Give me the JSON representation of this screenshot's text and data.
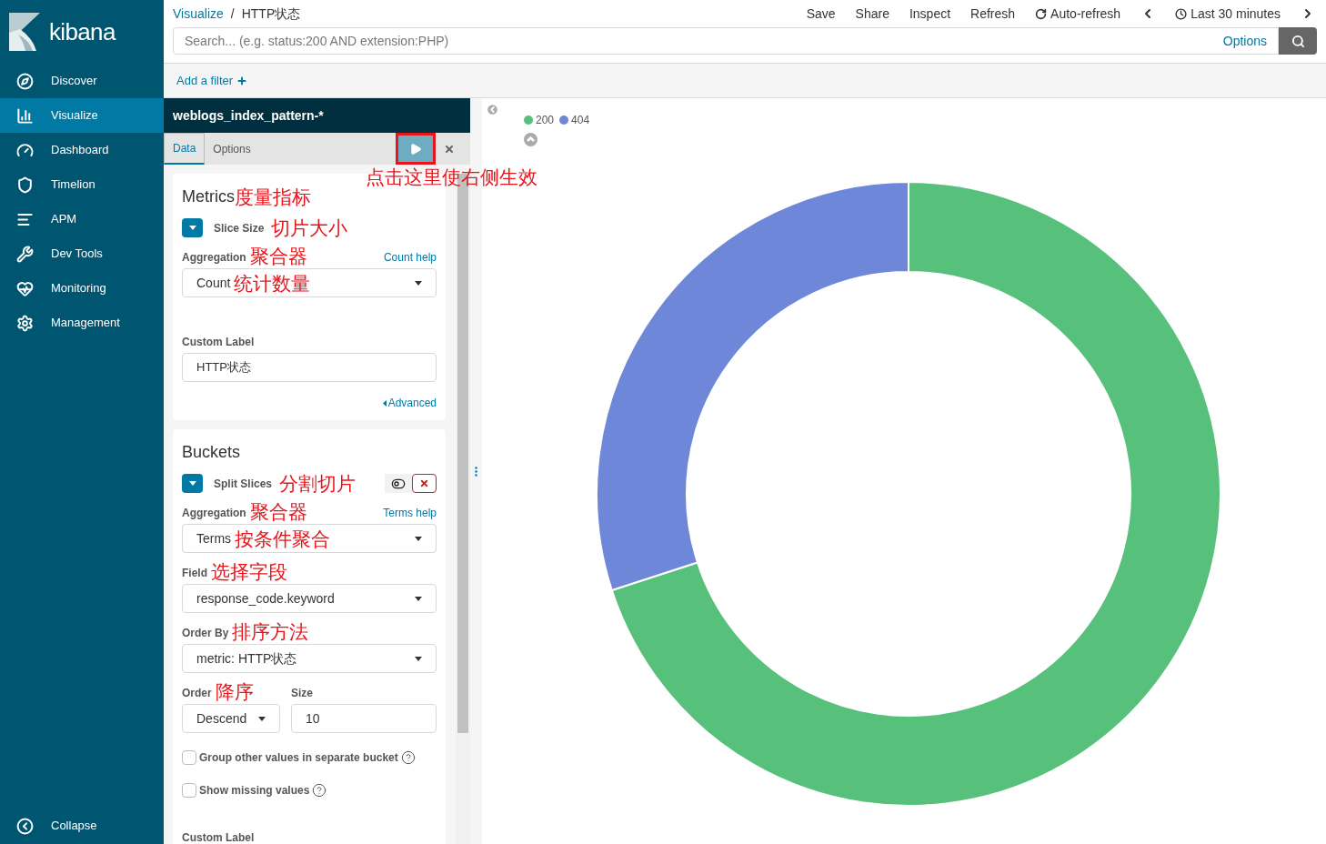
{
  "logo": {
    "text": "kibana"
  },
  "nav": [
    {
      "label": "Discover",
      "selected": false
    },
    {
      "label": "Visualize",
      "selected": true
    },
    {
      "label": "Dashboard",
      "selected": false
    },
    {
      "label": "Timelion",
      "selected": false
    },
    {
      "label": "APM",
      "selected": false
    },
    {
      "label": "Dev Tools",
      "selected": false
    },
    {
      "label": "Monitoring",
      "selected": false
    },
    {
      "label": "Management",
      "selected": false
    }
  ],
  "collapse": "Collapse",
  "breadcrumbs": [
    "Visualize",
    "HTTP状态"
  ],
  "breadcrumb_separator": "/",
  "top_menu": [
    "Save",
    "Share",
    "Inspect",
    "Refresh",
    "Auto-refresh"
  ],
  "time_range": "Last 30 minutes",
  "search": {
    "placeholder": "Search... (e.g. status:200 AND extension:PHP)",
    "options": "Options"
  },
  "add_filter": "Add a filter",
  "editor": {
    "index_pattern": "weblogs_index_pattern-*",
    "tabs": [
      {
        "label": "Data",
        "selected": true
      },
      {
        "label": "Options",
        "selected": false
      }
    ],
    "apply_note": "点击这里使右侧生效",
    "metrics": {
      "title": "Metrics",
      "title_note": "度量指标",
      "agg_title": "Slice Size",
      "agg_note": "切片大小",
      "aggregation_label": "Aggregation",
      "aggregation_note": "聚合器",
      "help": "Count help",
      "aggregation_value": "Count",
      "value_note": "统计数量",
      "custom_label": "Custom Label",
      "custom_value": "HTTP状态",
      "advanced": "Advanced"
    },
    "buckets": {
      "title": "Buckets",
      "agg_title": "Split Slices",
      "agg_note": "分割切片",
      "aggregation_label": "Aggregation",
      "aggregation_note": "聚合器",
      "help": "Terms help",
      "aggregation_value": "Terms",
      "value_note": "按条件聚合",
      "field_label": "Field",
      "field_note": "选择字段",
      "field_value": "response_code.keyword",
      "order_by_label": "Order By",
      "order_by_note": "排序方法",
      "order_by_value": "metric: HTTP状态",
      "order_label": "Order",
      "order_note": "降序",
      "order_value": "Descend",
      "size_label": "Size",
      "size_value": "10",
      "checkboxes": [
        {
          "label": "Group other values in separate bucket",
          "checked": false
        },
        {
          "label": "Show missing values",
          "checked": false
        }
      ],
      "custom_label": "Custom Label"
    }
  },
  "legend": [
    {
      "label": "200",
      "color": "#57c17b"
    },
    {
      "label": "404",
      "color": "#6f87d8"
    }
  ]
}
